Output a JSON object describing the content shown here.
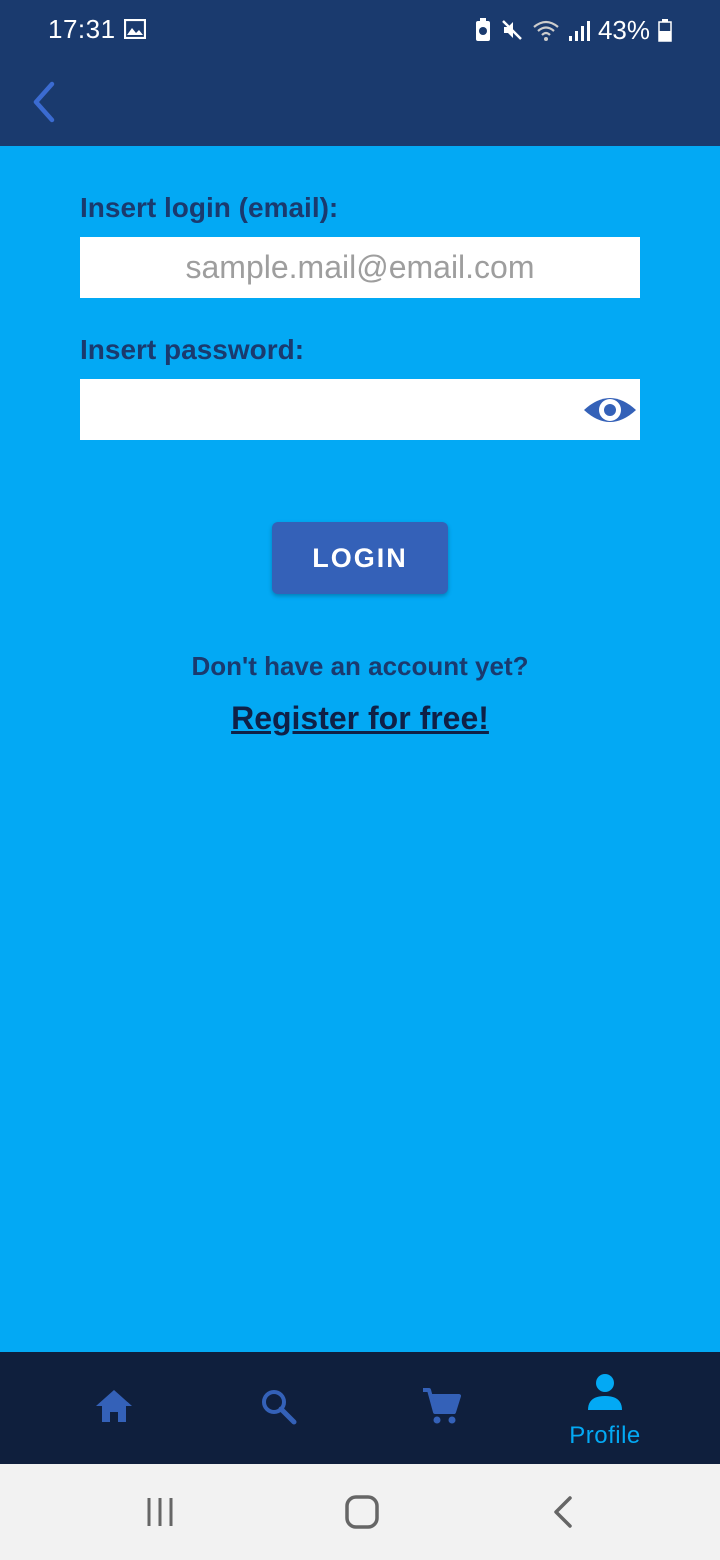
{
  "status_bar": {
    "time": "17:31",
    "battery": "43%"
  },
  "form": {
    "email_label": "Insert login (email):",
    "email_placeholder": "sample.mail@email.com",
    "email_value": "",
    "password_label": "Insert password:",
    "password_value": "",
    "login_button": "LOGIN",
    "no_account_text": "Don't have an account yet?",
    "register_link": "Register for free!"
  },
  "bottom_nav": {
    "items": [
      {
        "icon": "home-icon"
      },
      {
        "icon": "search-icon"
      },
      {
        "icon": "cart-icon"
      },
      {
        "icon": "profile-icon",
        "label": "Profile",
        "active": true
      }
    ]
  },
  "colors": {
    "background": "#03a9f4",
    "app_bar": "#1a3a6e",
    "accent_button": "#3461b8",
    "bottom_nav": "#0f1f3d",
    "active_nav": "#03a9f4"
  }
}
